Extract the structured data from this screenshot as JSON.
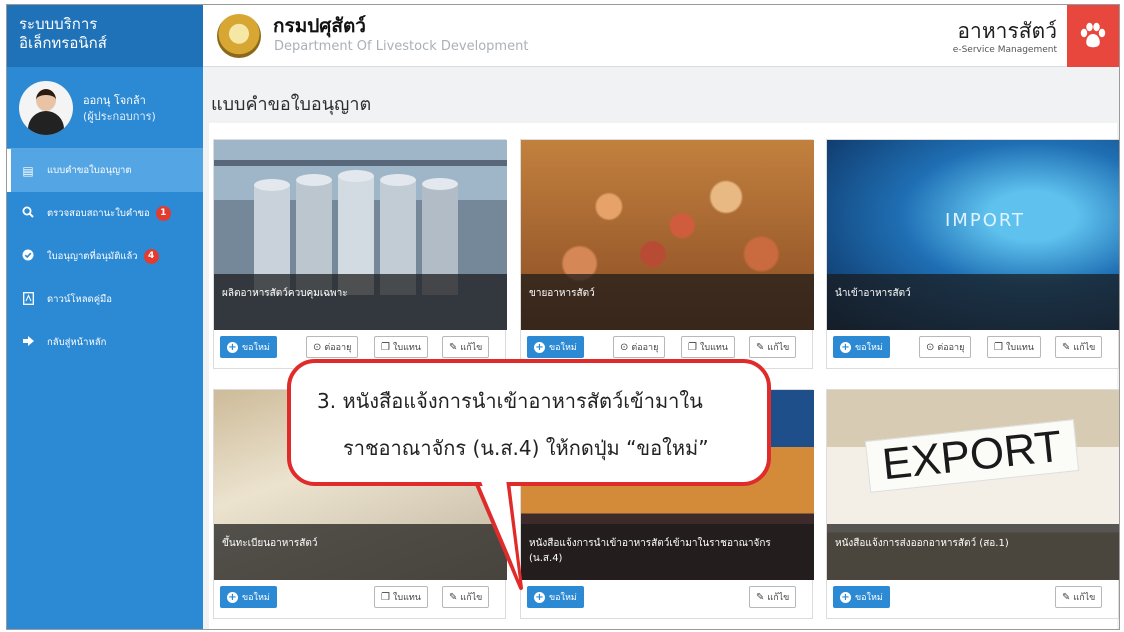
{
  "header": {
    "system_title_line1": "ระบบบริการ",
    "system_title_line2": "อิเล็กทรอนิกส์",
    "org_name": "กรมปศุสัตว์",
    "org_subtitle": "Department Of Livestock Development",
    "service_name": "อาหารสัตว์",
    "service_subtitle": "e-Service Management",
    "accent_color": "#e8473e"
  },
  "user": {
    "name": "ออกนุ โจกล้า",
    "role": "(ผู้ประกอบการ)"
  },
  "sidebar": {
    "items": [
      {
        "icon": "document-icon",
        "label": "แบบคำขอใบอนุญาต",
        "active": true
      },
      {
        "icon": "search-icon",
        "label": "ตรวจสอบสถานะใบคำขอ",
        "badge": "1"
      },
      {
        "icon": "check-circle-icon",
        "label": "ใบอนุญาตที่อนุมัติแล้ว",
        "badge": "4"
      },
      {
        "icon": "pdf-icon",
        "label": "ดาวน์โหลดคู่มือ"
      },
      {
        "icon": "sign-out-icon",
        "label": "กลับสู่หน้าหลัก"
      }
    ]
  },
  "main": {
    "title": "แบบคำขอใบอนุญาต",
    "buttons": {
      "new": "ขอใหม่",
      "renew": "ต่ออายุ",
      "replace": "ใบแทน",
      "edit": "แก้ไข"
    },
    "cards": [
      {
        "caption": "ผลิตอาหารสัตว์ควบคุมเฉพาะ"
      },
      {
        "caption": "ขายอาหารสัตว์"
      },
      {
        "caption": "นำเข้าอาหารสัตว์",
        "image_text": "IMPORT"
      },
      {
        "caption": "ขึ้นทะเบียนอาหารสัตว์"
      },
      {
        "caption": "หนังสือแจ้งการนำเข้าอาหารสัตว์เข้ามาในราชอาณาจักร (น.ส.4)"
      },
      {
        "caption": "หนังสือแจ้งการส่งออกอาหารสัตว์ (สอ.1)",
        "image_text": "EXPORT"
      }
    ]
  },
  "callout": {
    "line1": "3. หนังสือแจ้งการนำเข้าอาหารสัตว์เข้ามาใน",
    "line2": "ราชอาณาจักร (น.ส.4) ให้กดปุ่ม “ขอใหม่”",
    "border_color": "#e02b2b"
  }
}
